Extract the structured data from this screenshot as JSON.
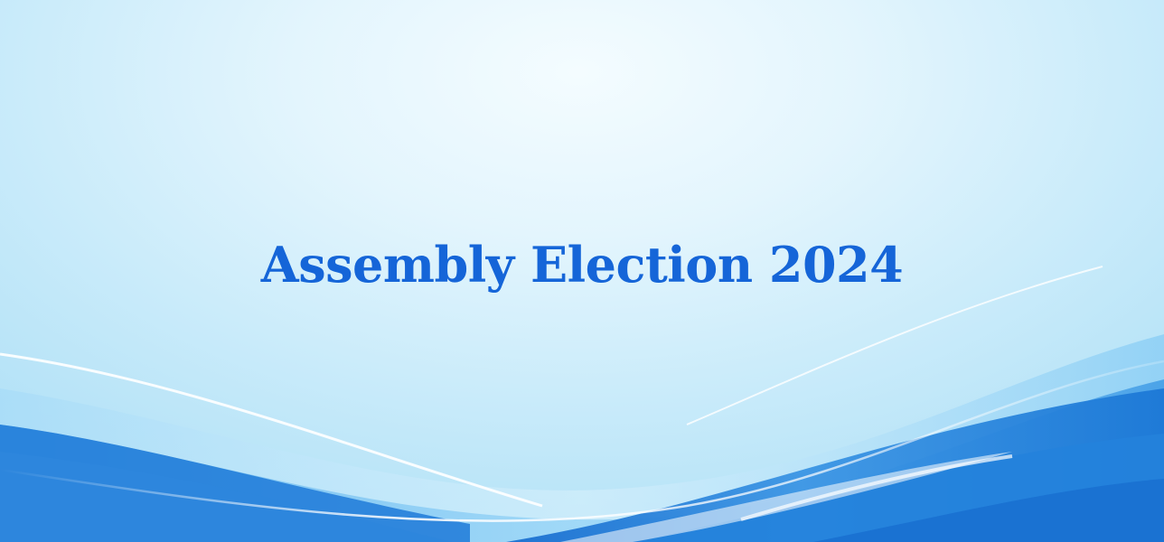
{
  "banner": {
    "headline": "Assembly Election 2024"
  },
  "colors": {
    "headline": "#1565d8",
    "wave_deep": "#1c78d6",
    "wave_mid": "#3f9be6",
    "wave_light": "#8fd0f5",
    "highlight": "#ffffff"
  }
}
